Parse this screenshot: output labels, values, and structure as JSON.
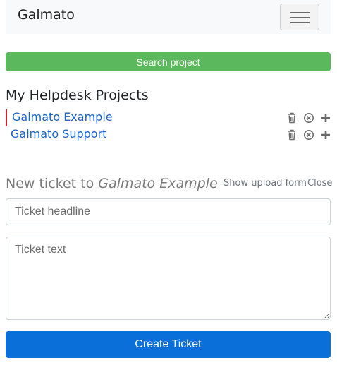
{
  "navbar": {
    "brand": "Galmato",
    "menu_icon": "hamburger-menu-icon"
  },
  "search": {
    "button_label": "Search project",
    "color": "#5cb85c"
  },
  "projects": {
    "title": "My Helpdesk Projects",
    "items": [
      {
        "name": "Galmato Example",
        "active": true
      },
      {
        "name": "Galmato Support",
        "active": false
      }
    ],
    "action_icons": [
      "trash-icon",
      "remove-circle-icon",
      "plus-icon"
    ],
    "active_marker_color": "#d9232d",
    "link_color": "#1a64c8"
  },
  "new_ticket": {
    "heading_prefix": "New ticket to",
    "project_name": "Galmato Example",
    "show_upload_label": "Show upload form",
    "close_label": "Close",
    "headline_placeholder": "Ticket headline",
    "text_placeholder": "Ticket text",
    "submit_label": "Create Ticket",
    "submit_color": "#0a6fd8"
  }
}
